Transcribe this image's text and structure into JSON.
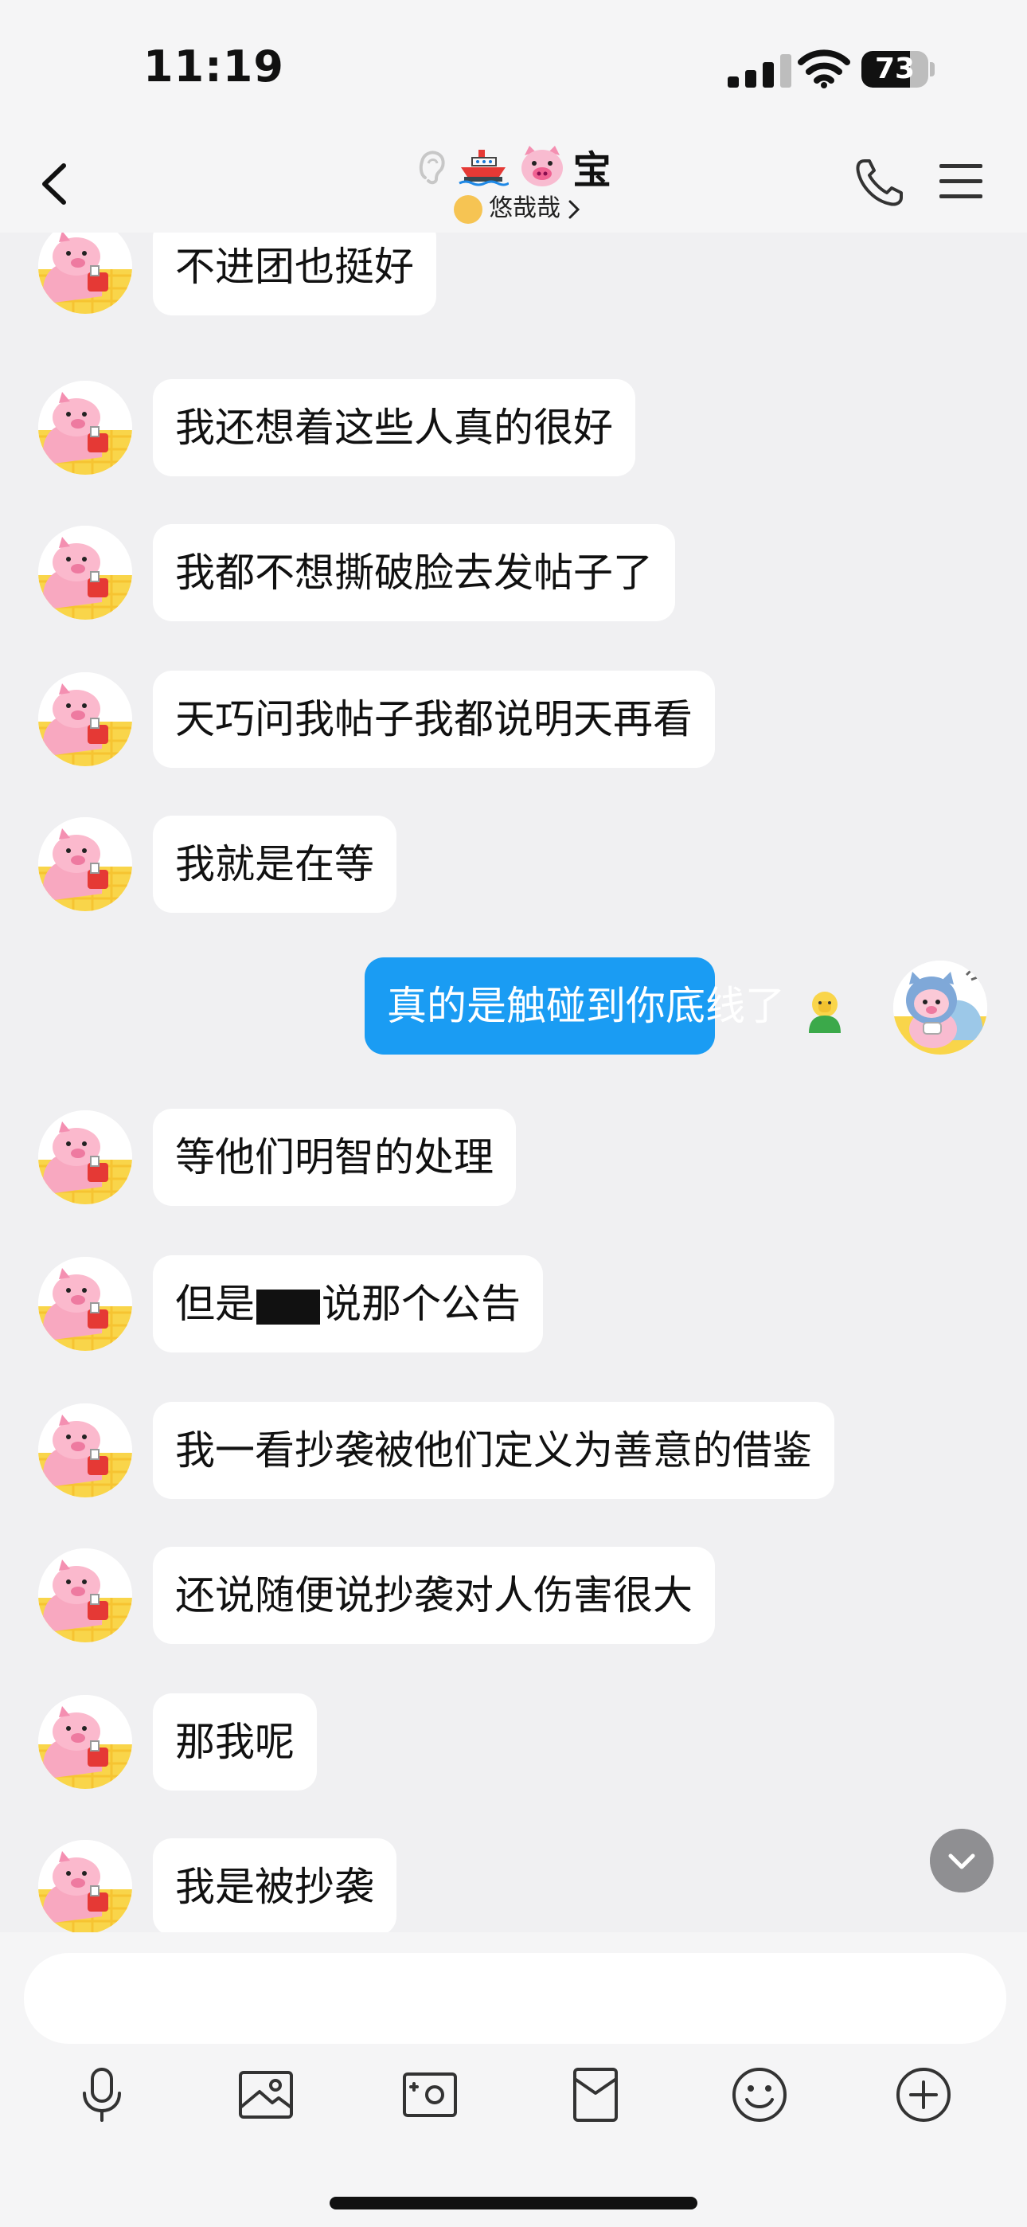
{
  "status_bar": {
    "time": "11:19",
    "battery": "73",
    "battery_level": 0.73
  },
  "header": {
    "title_text": "宝",
    "title_icons": [
      "ear-icon",
      "ship-icon",
      "pig-face-icon"
    ],
    "subtitle": "悠哉哉",
    "colors": {
      "background": "#f5f5f6"
    }
  },
  "messages": [
    {
      "from": "them",
      "text": "不进团也挺好"
    },
    {
      "from": "them",
      "text": "我还想着这些人真的很好"
    },
    {
      "from": "them",
      "text": "我都不想撕破脸去发帖子了"
    },
    {
      "from": "them",
      "text": "天巧问我帖子我都说明天再看"
    },
    {
      "from": "them",
      "text": "我就是在等"
    },
    {
      "from": "me",
      "text": "真的是触碰到你底线了",
      "emoji": "facepalm-emoji"
    },
    {
      "from": "them",
      "text": "等他们明智的处理"
    },
    {
      "from": "them",
      "text_before": "但是",
      "text_after": "说那个公告",
      "redacted": true
    },
    {
      "from": "them",
      "text": "我一看抄袭被他们定义为善意的借鉴"
    },
    {
      "from": "them",
      "text": "还说随便说抄袭对人伤害很大"
    },
    {
      "from": "them",
      "text": "那我呢"
    },
    {
      "from": "them",
      "text": "我是被抄袭"
    }
  ],
  "input": {
    "placeholder": ""
  },
  "toolbar": [
    "microphone-icon",
    "image-icon",
    "camera-icon",
    "red-packet-icon",
    "emoji-icon",
    "plus-icon"
  ],
  "colors": {
    "my_bubble": "#1a9cf3",
    "their_bubble": "#ffffff",
    "chat_background": "#f0f0f2"
  }
}
